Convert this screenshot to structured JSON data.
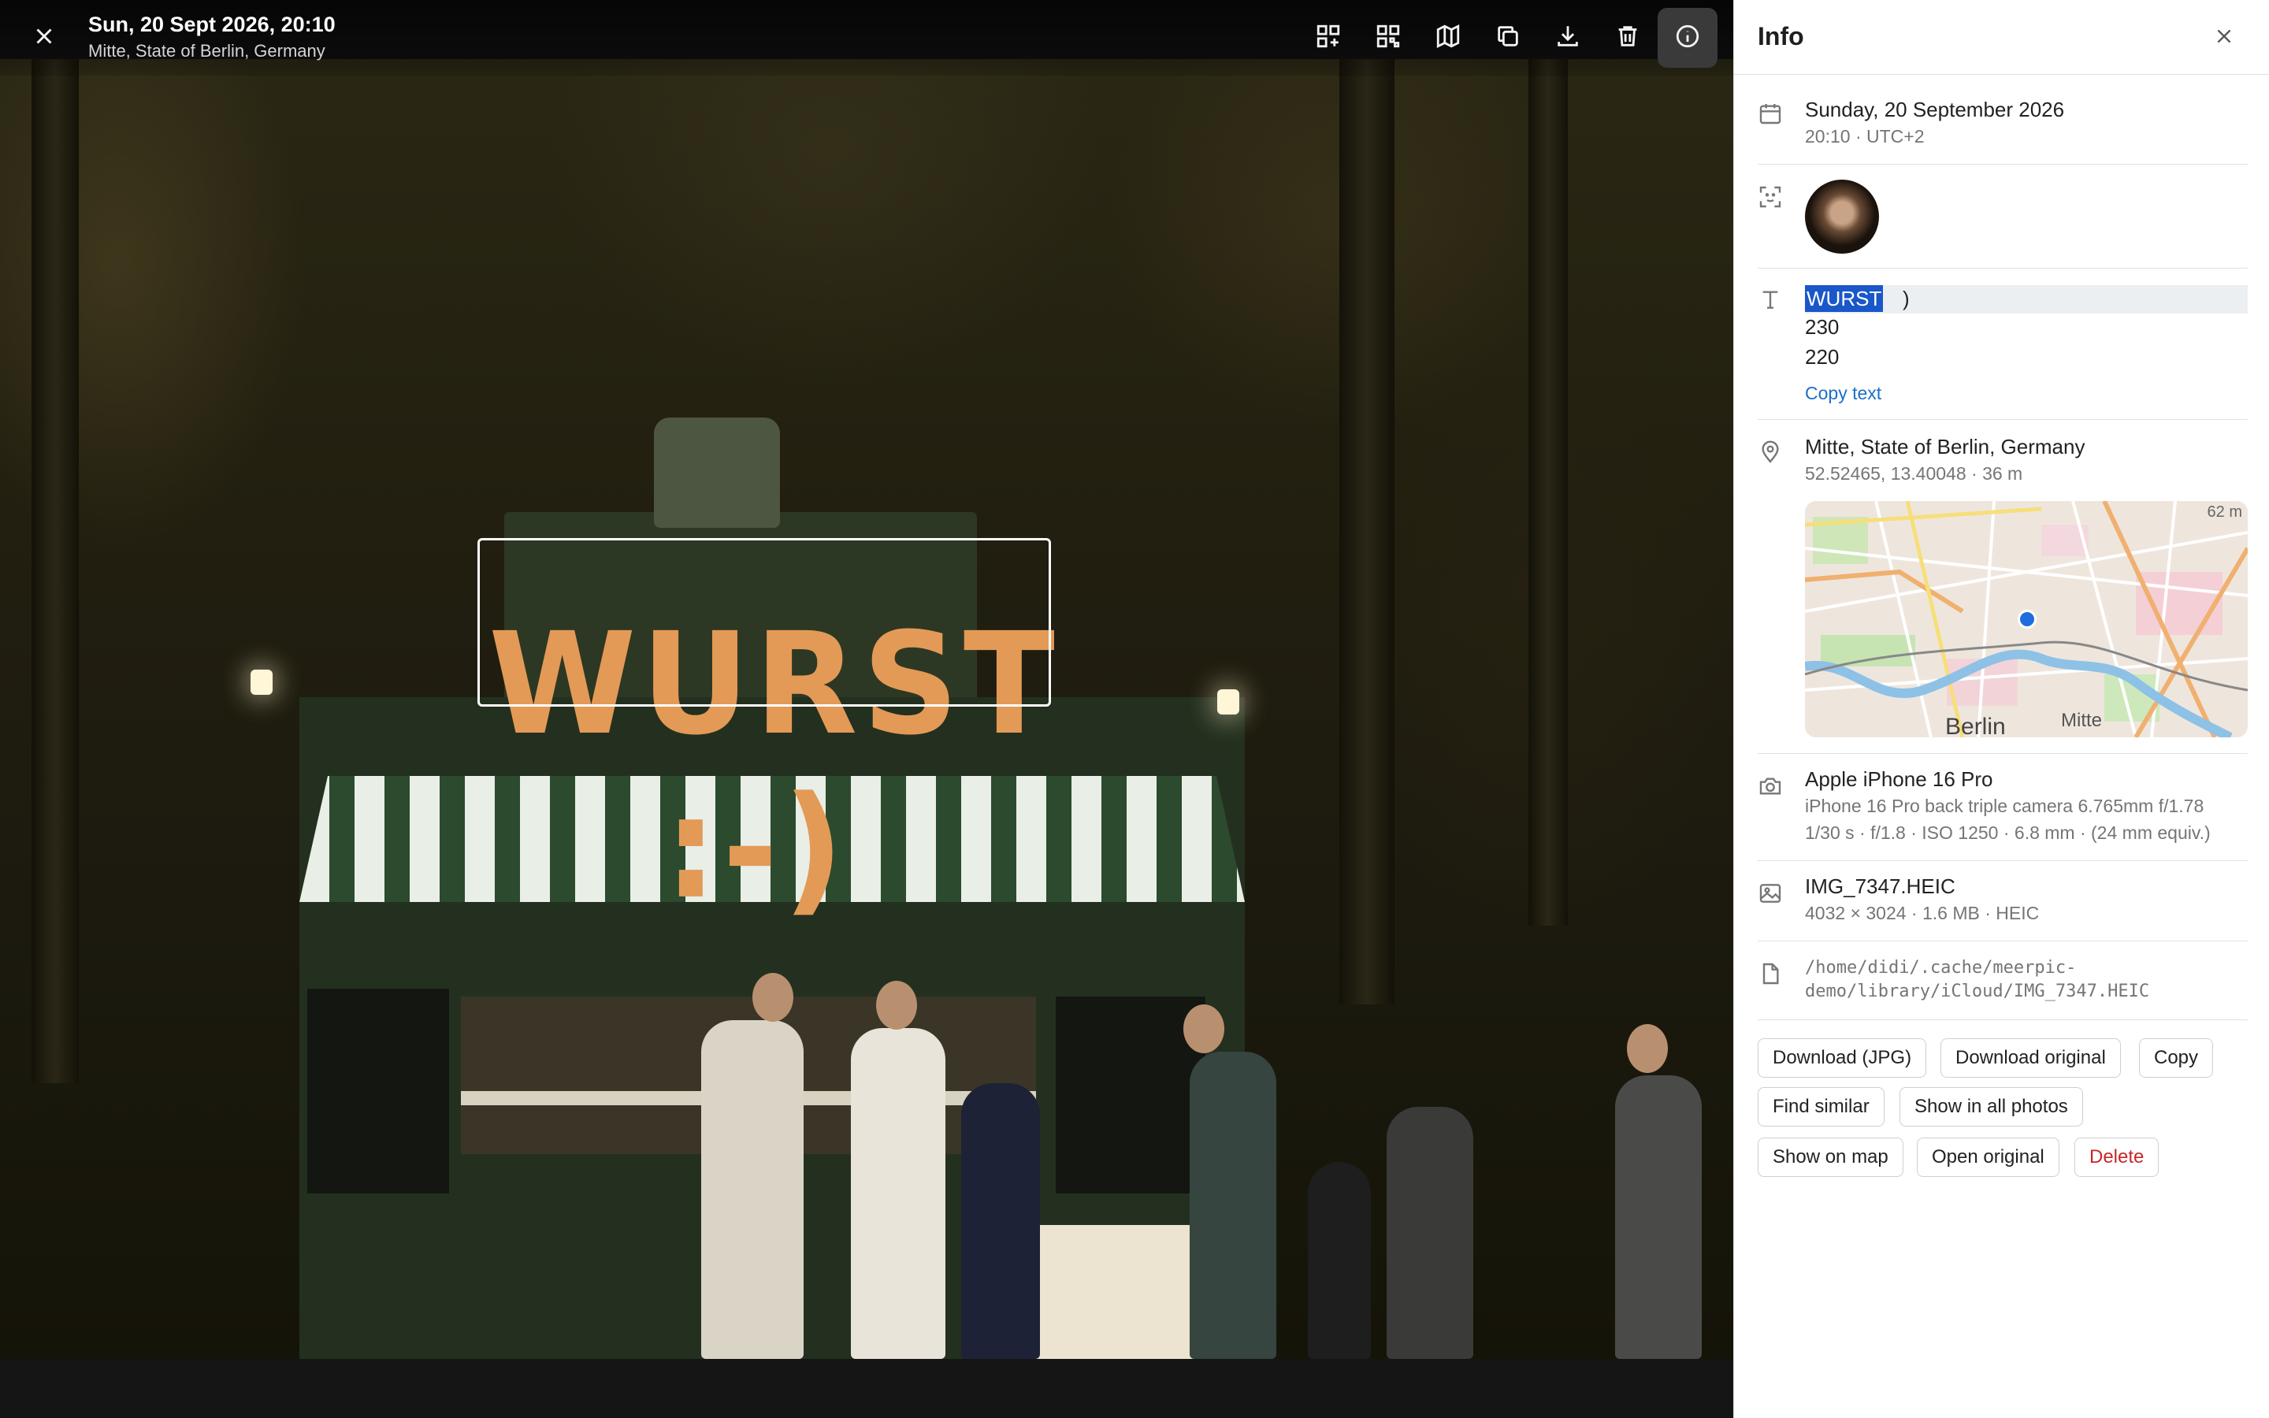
{
  "viewer": {
    "title_date": "Sun, 20 Sept 2026, 20:10",
    "title_place": "Mitte, State of Berlin, Germany",
    "toolbar_icons": [
      "add-to-collection-icon",
      "qr-code-icon",
      "map-icon",
      "copy-icon",
      "download-icon",
      "trash-icon",
      "info-icon"
    ],
    "photo_sign": "WURST :-)"
  },
  "info": {
    "title": "Info",
    "date": {
      "primary": "Sunday, 20 September 2026",
      "secondary": "20:10 · UTC+2"
    },
    "ocr": {
      "selected": "WURST",
      "line1_rest": ")",
      "line2": "230",
      "line3": "220",
      "copy_label": "Copy text"
    },
    "location": {
      "primary": "Mitte, State of Berlin, Germany",
      "secondary": "52.52465, 13.40048 · 36 m",
      "map_scale": "62 m",
      "map_label_berlin": "Berlin",
      "map_label_mitte": "Mitte"
    },
    "camera": {
      "primary": "Apple iPhone 16 Pro",
      "lens": "iPhone 16 Pro back triple camera 6.765mm f/1.78",
      "exposure": "1/30 s · f/1.8 · ISO 1250 · 6.8 mm · (24 mm equiv.)"
    },
    "file": {
      "primary": "IMG_7347.HEIC",
      "secondary": "4032 × 3024 · 1.6 MB · HEIC"
    },
    "path": {
      "line1": "/home/didi/.cache/meerpic-",
      "line2": "demo/library/iCloud/IMG_7347.HEIC"
    },
    "actions": {
      "download_jpg": "Download (JPG)",
      "download_original": "Download original",
      "copy": "Copy",
      "find_similar": "Find similar",
      "show_in_all": "Show in all photos",
      "show_on_map": "Show on map",
      "open_original": "Open original",
      "delete": "Delete"
    },
    "colors": {
      "link": "#1a6fc9",
      "danger": "#c62828",
      "selection": "#1a57c8",
      "map_pin": "#1e6de0"
    }
  }
}
